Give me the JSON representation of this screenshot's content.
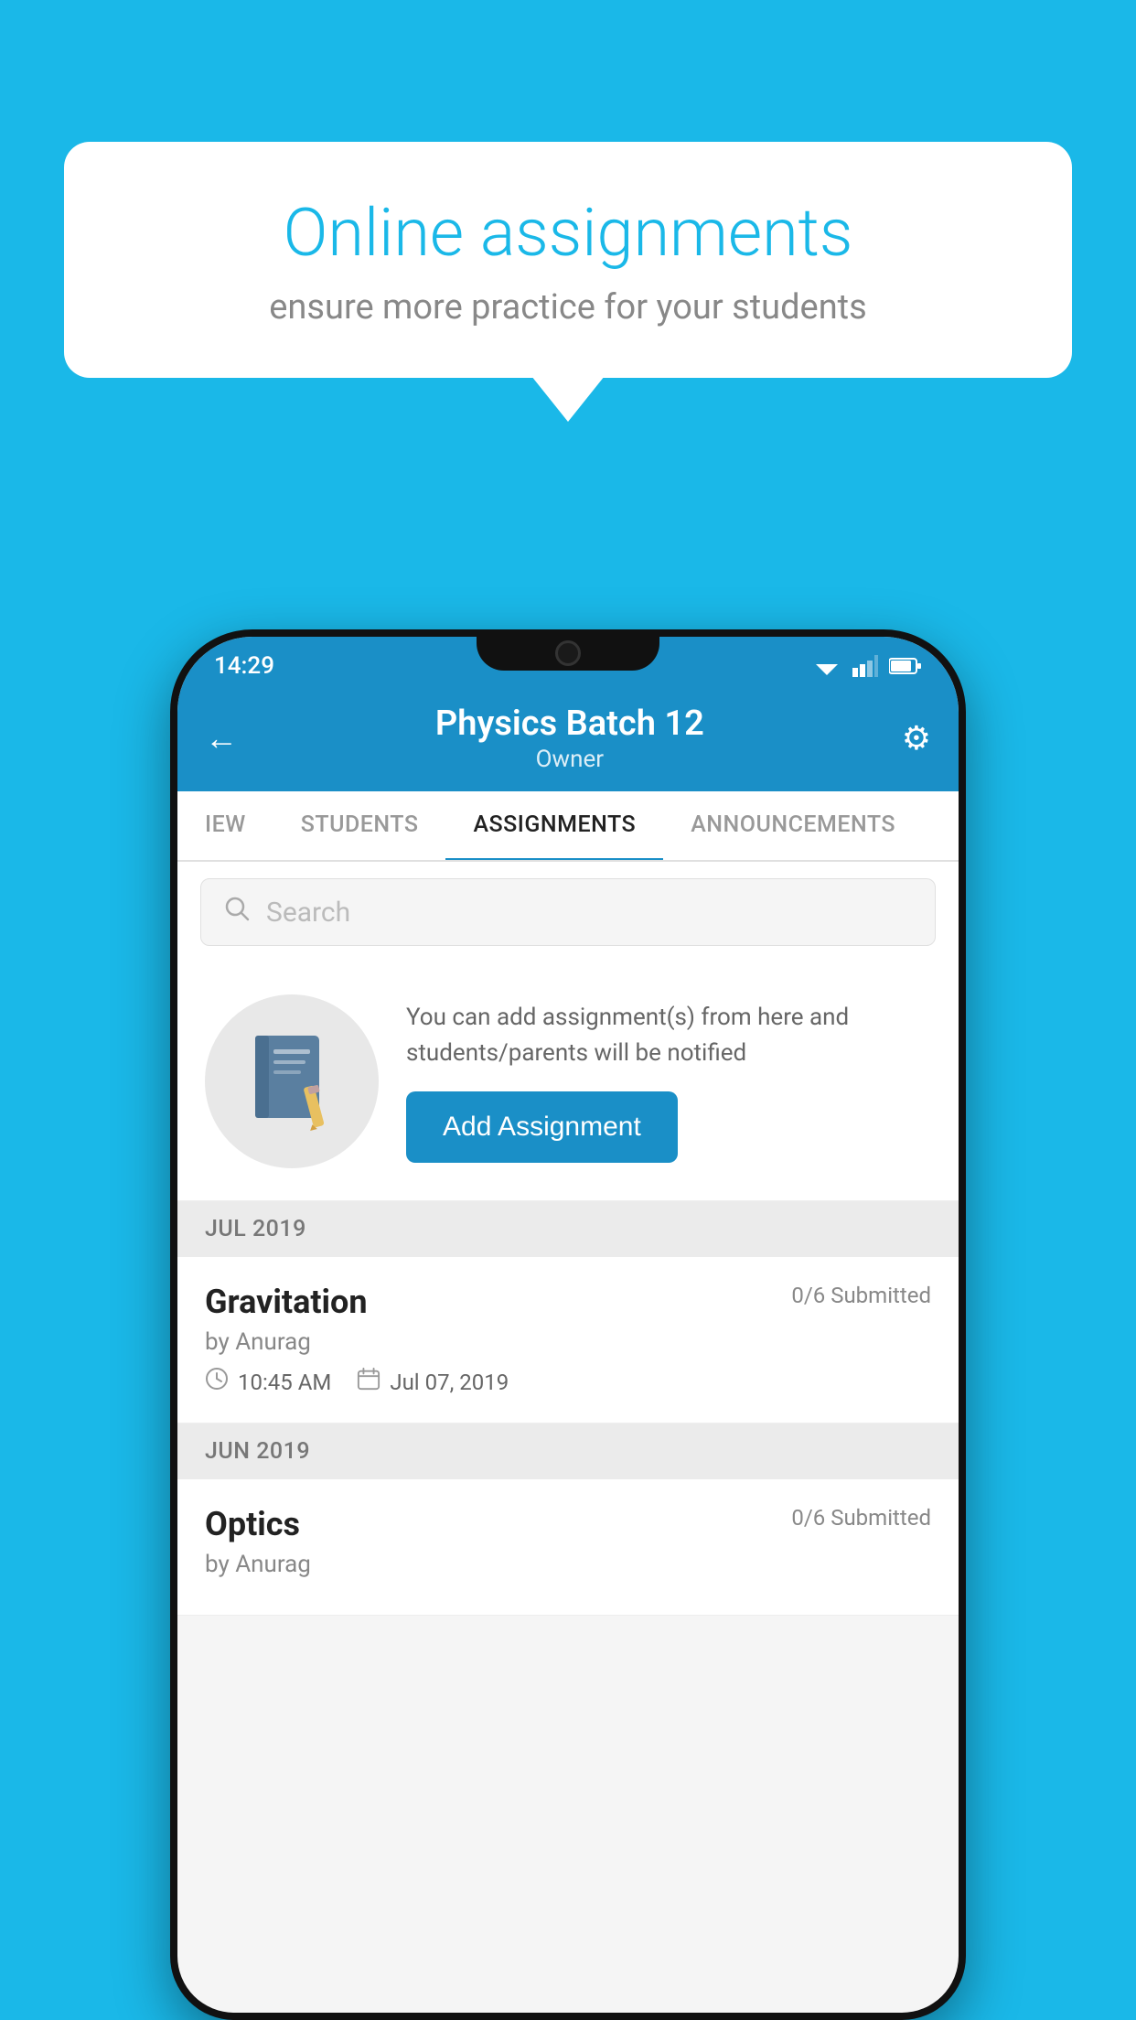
{
  "background_color": "#1ab8e8",
  "speech_bubble": {
    "title": "Online assignments",
    "subtitle": "ensure more practice for your students"
  },
  "phone": {
    "status_bar": {
      "time": "14:29"
    },
    "header": {
      "title": "Physics Batch 12",
      "subtitle": "Owner",
      "back_label": "←",
      "settings_label": "⚙"
    },
    "tabs": [
      {
        "label": "IEW",
        "active": false
      },
      {
        "label": "STUDENTS",
        "active": false
      },
      {
        "label": "ASSIGNMENTS",
        "active": true
      },
      {
        "label": "ANNOUNCEMENTS",
        "active": false
      }
    ],
    "search": {
      "placeholder": "Search"
    },
    "promo": {
      "text": "You can add assignment(s) from here and students/parents will be notified",
      "button_label": "Add Assignment"
    },
    "sections": [
      {
        "label": "JUL 2019",
        "assignments": [
          {
            "title": "Gravitation",
            "submitted": "0/6 Submitted",
            "by": "by Anurag",
            "time": "10:45 AM",
            "date": "Jul 07, 2019"
          }
        ]
      },
      {
        "label": "JUN 2019",
        "assignments": [
          {
            "title": "Optics",
            "submitted": "0/6 Submitted",
            "by": "by Anurag",
            "time": "",
            "date": ""
          }
        ]
      }
    ]
  }
}
